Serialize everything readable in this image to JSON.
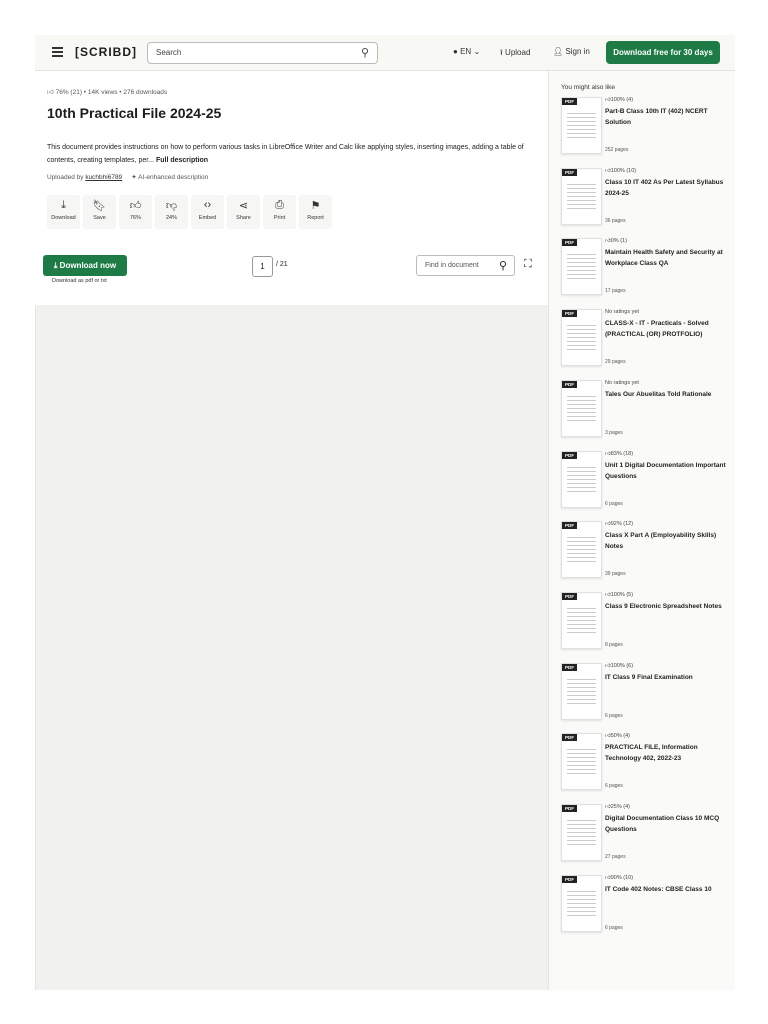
{
  "header": {
    "logo": "[SCRIBD]",
    "search_placeholder": "Search",
    "lang": "EN",
    "upload": "Upload",
    "signin": "Sign in",
    "cta": "Download free for 30 days"
  },
  "doc": {
    "meta": "76% (21)  •  14K views  •  276 downloads",
    "title": "10th Practical File 2024-25",
    "description": "This document provides instructions on how to perform various tasks in LibreOffice Writer and Calc like applying styles, inserting images, adding a table of contents, creating templates, per...",
    "full_description": "Full description",
    "uploaded_by_label": "Uploaded by",
    "uploader": "kuchbhi6789",
    "ai_label": "AI-enhanced description"
  },
  "actions": [
    {
      "icon": "download-icon",
      "glyph": "⤓",
      "label": "Download"
    },
    {
      "icon": "bookmark-icon",
      "glyph": "🔖︎",
      "label": "Save"
    },
    {
      "icon": "thumbs-up-icon",
      "glyph": "👍︎",
      "label": "76%"
    },
    {
      "icon": "thumbs-down-icon",
      "glyph": "👎︎",
      "label": "24%"
    },
    {
      "icon": "embed-icon",
      "glyph": "‹›",
      "label": "Embed"
    },
    {
      "icon": "share-icon",
      "glyph": "⋖",
      "label": "Share"
    },
    {
      "icon": "print-icon",
      "glyph": "⎙",
      "label": "Print"
    },
    {
      "icon": "flag-icon",
      "glyph": "⚑",
      "label": "Report"
    }
  ],
  "viewer": {
    "download_now": "Download now",
    "download_sub": "Download as pdf or txt",
    "page": "1",
    "total": "/ 21",
    "find_placeholder": "Find in document"
  },
  "sidebar": {
    "heading": "You might also like",
    "items": [
      {
        "rating": "100% (4)",
        "title": "Part-B Class 10th IT (402) NCERT Solution",
        "pages": "252 pages"
      },
      {
        "rating": "100% (10)",
        "title": "Class 10 IT 402 As Per Latest Syllabus 2024-25",
        "pages": "36 pages"
      },
      {
        "rating": "0% (1)",
        "title": "Maintain Health Safety and Security at Workplace Class QA",
        "pages": "17 pages"
      },
      {
        "rating": "No ratings yet",
        "title": "CLASS-X - IT - Practicals - Solved (PRACTICAL (OR) PROTFOLIO)",
        "pages": "29 pages"
      },
      {
        "rating": "No ratings yet",
        "title": "Tales Our Abuelitas Told Rationale",
        "pages": "3 pages"
      },
      {
        "rating": "83% (18)",
        "title": "Unit 1 Digital Documentation Important Questions",
        "pages": "6 pages"
      },
      {
        "rating": "92% (12)",
        "title": "Class X Part A (Employability Skills) Notes",
        "pages": "39 pages"
      },
      {
        "rating": "100% (5)",
        "title": "Class 9 Electronic Spreadsheet Notes",
        "pages": "8 pages"
      },
      {
        "rating": "100% (6)",
        "title": "IT Class 9 Final Examination",
        "pages": "6 pages"
      },
      {
        "rating": "50% (4)",
        "title": "PRACTICAL FILE, Information Technology 402, 2022-23",
        "pages": "6 pages"
      },
      {
        "rating": "25% (4)",
        "title": "Digital Documentation Class 10 MCQ Questions",
        "pages": "27 pages"
      },
      {
        "rating": "90% (10)",
        "title": "IT Code 402 Notes: CBSE Class 10",
        "pages": "6 pages"
      }
    ]
  },
  "pdf_badge": "PDF"
}
